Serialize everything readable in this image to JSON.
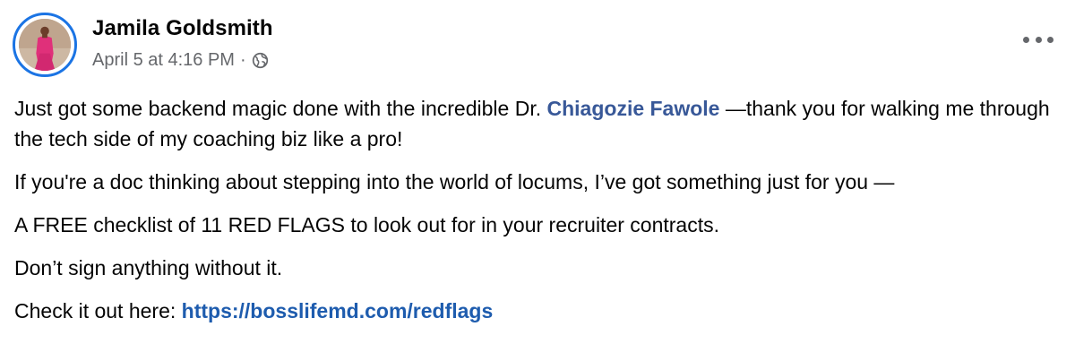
{
  "author": {
    "name": "Jamila Goldsmith",
    "timestamp": "April 5 at 4:16 PM",
    "separator": "·",
    "audience_icon": "globe-icon"
  },
  "menu_icon": "more-options-icon",
  "post": {
    "p1_before": "Just got some backend magic done with the incredible Dr. ",
    "p1_mention": "Chiagozie Fawole",
    "p1_after": " —thank you for walking me through the tech side of my coaching biz like a pro!",
    "p2": "If you're a doc thinking about stepping into the world of locums, I’ve got something just for you —",
    "p3": "A FREE checklist of 11 RED FLAGS to look out for in your recruiter contracts.",
    "p4": "Don’t sign anything without it.",
    "p5_before": "Check it out here: ",
    "p5_link": "https://bosslifemd.com/redflags"
  },
  "colors": {
    "link": "#1e5cae",
    "mention": "#385898",
    "meta": "#65676b",
    "avatar_ring": "#1b74e4"
  }
}
